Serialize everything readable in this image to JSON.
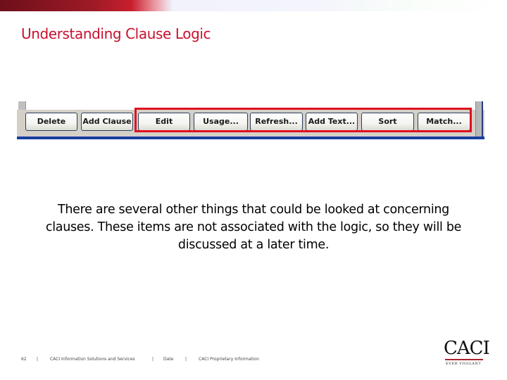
{
  "slide": {
    "title": "Understanding Clause Logic",
    "body": "There are several other things that could be looked at concerning clauses.  These items are not associated with the logic, so they will be discussed at a later time."
  },
  "toolbar": {
    "buttons": [
      {
        "label": "Delete",
        "highlighted": false
      },
      {
        "label": "Add Clause",
        "highlighted": false
      },
      {
        "label": "Edit",
        "highlighted": true
      },
      {
        "label": "Usage...",
        "highlighted": true
      },
      {
        "label": "Refresh...",
        "highlighted": true
      },
      {
        "label": "Add Text...",
        "highlighted": true
      },
      {
        "label": "Sort",
        "highlighted": true
      },
      {
        "label": "Match...",
        "highlighted": true
      }
    ],
    "highlight_color": "#e01020"
  },
  "footer": {
    "page_number": "62",
    "separator": "|",
    "company": "CACI Information Solutions and Services",
    "date_label": "Date",
    "classification": "CACI Proprietary Information"
  },
  "logo": {
    "wordmark": "CACI",
    "tagline": "EVER VIGILANT"
  },
  "colors": {
    "title": "#c8102e",
    "toolbar_bg": "#d4d0c8",
    "toolbar_line": "#1a3fa0"
  }
}
